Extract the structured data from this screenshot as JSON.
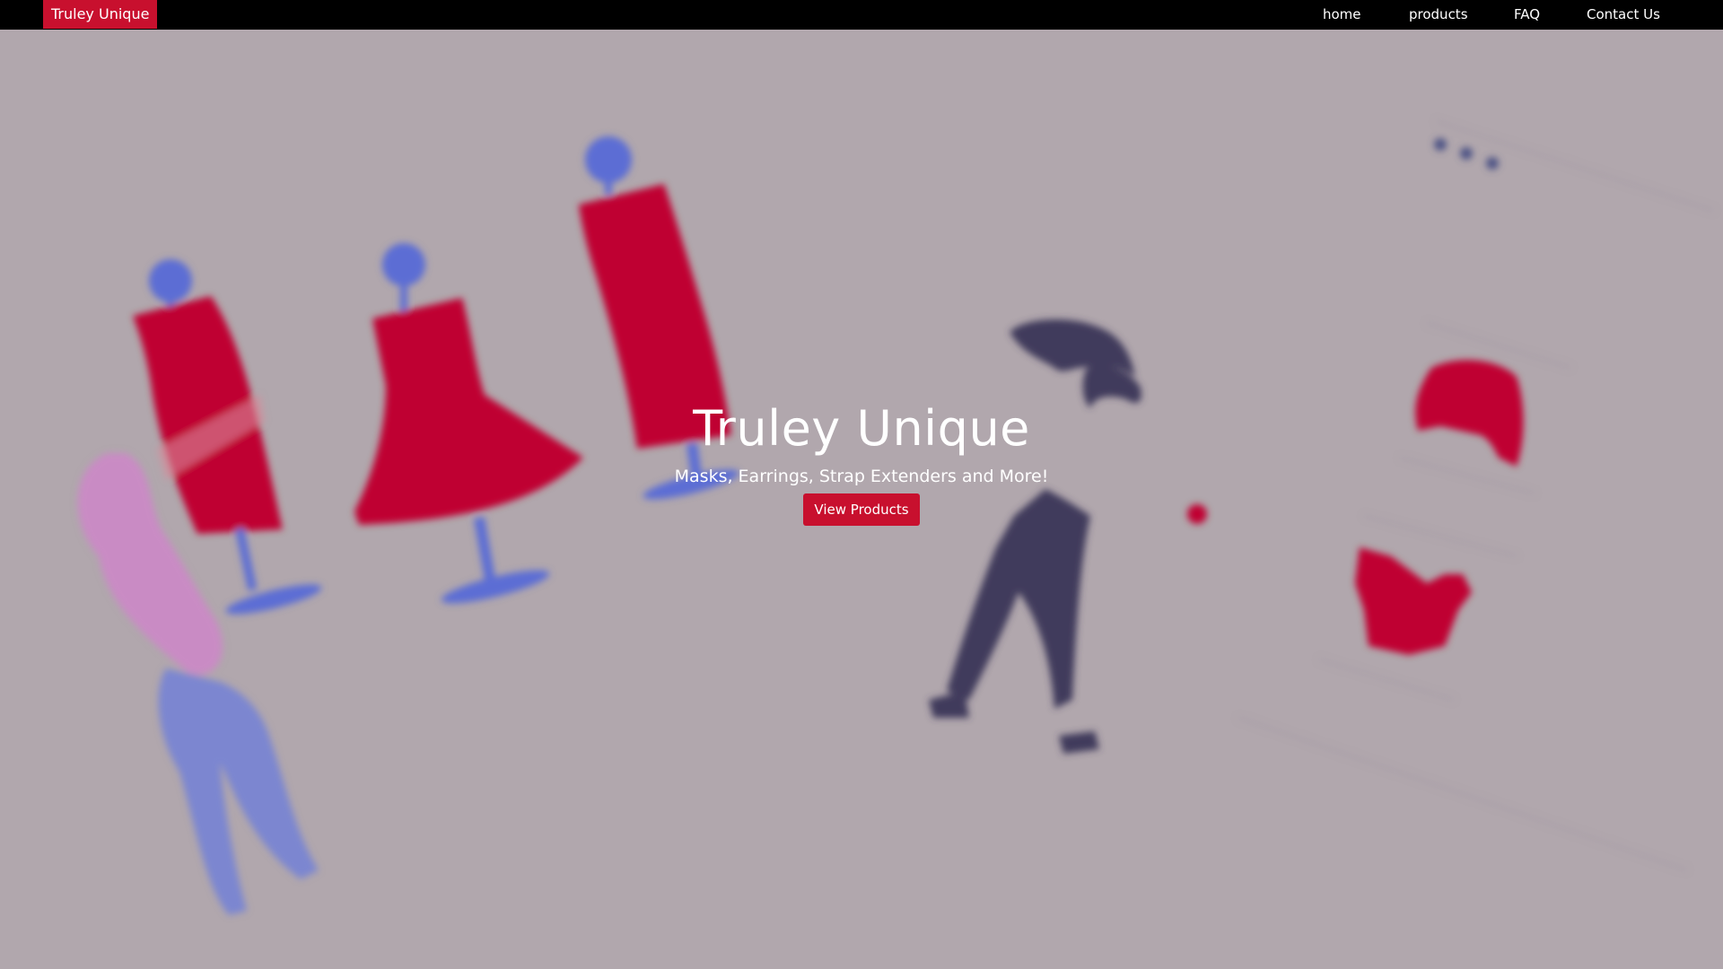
{
  "navbar": {
    "brand": "Truley Unique",
    "links": [
      {
        "label": "home"
      },
      {
        "label": "products"
      },
      {
        "label": "FAQ"
      },
      {
        "label": "Contact Us"
      }
    ]
  },
  "hero": {
    "title": "Truley Unique",
    "subtitle": "Masks, Earrings, Strap Extenders and More!",
    "button_label": "View Products",
    "illustration": "fashion-mannequins-and-clothing-illustration"
  },
  "colors": {
    "navbar_bg": "#000000",
    "accent": "#c8102e",
    "hero_bg": "#b1a7ad",
    "figure_blue": "#5b6dd4",
    "figure_dark": "#3f3a5c",
    "figure_pink": "#d58fcd"
  }
}
